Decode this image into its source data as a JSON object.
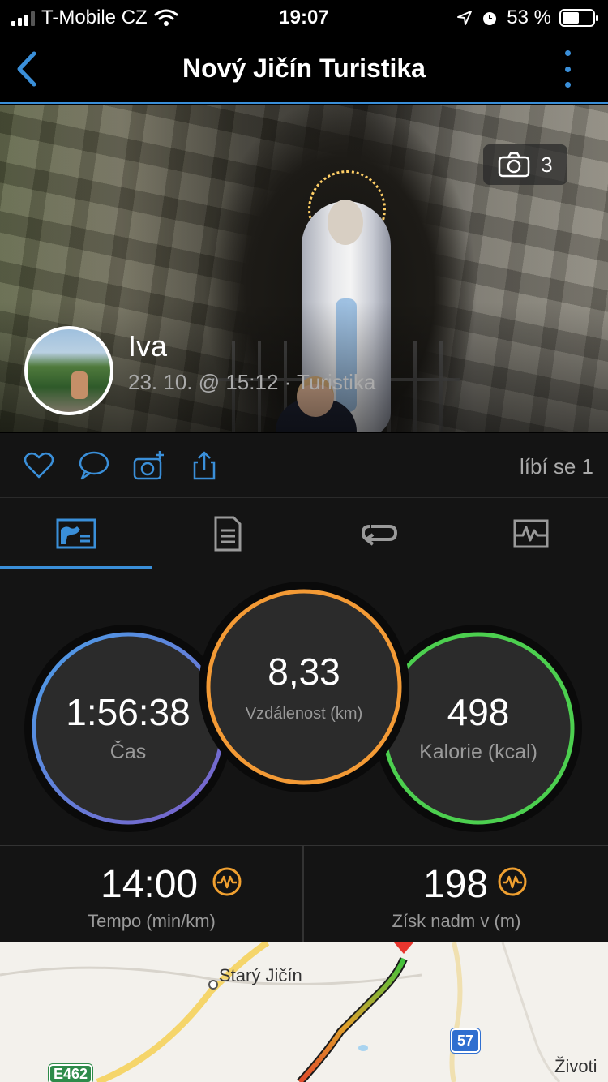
{
  "status_bar": {
    "carrier": "T-Mobile CZ",
    "time": "19:07",
    "battery": "53 %",
    "icons": [
      "signal-icon",
      "wifi-icon",
      "location-arrow-icon",
      "alarm-icon",
      "battery-icon"
    ]
  },
  "nav": {
    "title": "Nový Jičín Turistika",
    "back_icon": "chevron-left-icon",
    "menu_icon": "vertical-dots-icon"
  },
  "activity": {
    "photo_count": "3",
    "user_name": "Iva",
    "meta": "23. 10. @ 15:12 · Turistika"
  },
  "actions": {
    "icons": [
      "heart-icon",
      "comment-icon",
      "add-photo-icon",
      "share-icon"
    ],
    "likes_text": "líbí se 1"
  },
  "tabs": {
    "items": [
      "overview-tab-icon",
      "details-tab-icon",
      "laps-tab-icon",
      "charts-tab-icon"
    ],
    "selected_index": 0
  },
  "stats": {
    "time": {
      "value": "1:56:38",
      "label": "Čas"
    },
    "distance": {
      "value": "8,33",
      "label": "Vzdálenost (km)"
    },
    "calories": {
      "value": "498",
      "label": "Kalorie (kcal)"
    },
    "pace": {
      "value": "14:00",
      "label": "Tempo (min/km)"
    },
    "elevation": {
      "value": "198",
      "label": "Získ nadm v (m)"
    }
  },
  "colors": {
    "accent": "#3a8fd9",
    "time_ring_start": "#4a9ee8",
    "time_ring_end": "#7b5fc9",
    "distance_ring": "#f39a35",
    "calories_ring": "#4ccf4f",
    "badge_orange": "#f0a030"
  },
  "map": {
    "places": [
      "Starý Jičín",
      "Životi"
    ],
    "road_shields": [
      "E462",
      "57"
    ]
  }
}
